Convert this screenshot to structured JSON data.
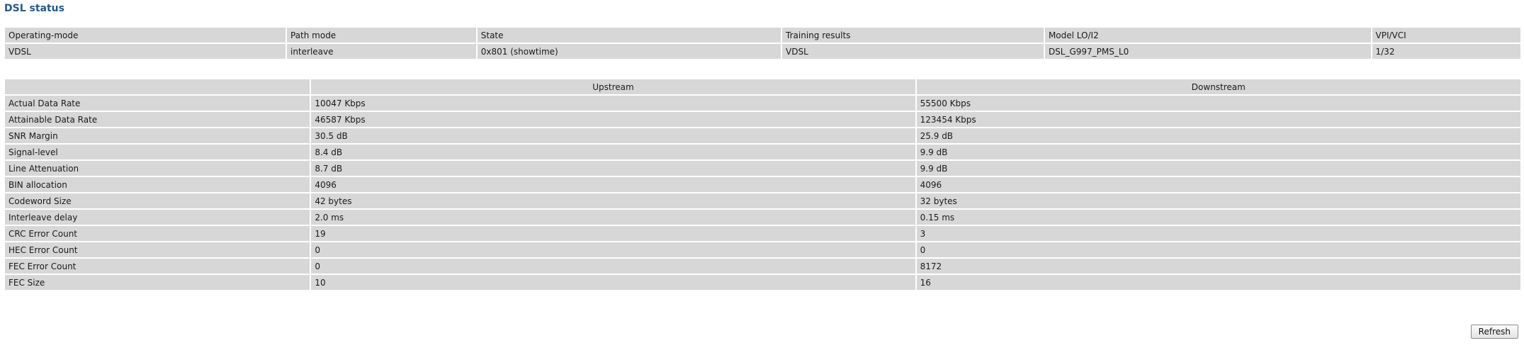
{
  "title": "DSL status",
  "summary": {
    "headers": [
      "Operating-mode",
      "Path mode",
      "State",
      "Training results",
      "Model LO/I2",
      "VPI/VCI"
    ],
    "values": [
      "VDSL",
      "interleave",
      "0x801 (showtime)",
      "VDSL",
      "DSL_G997_PMS_L0",
      "1/32"
    ]
  },
  "stats": {
    "headers": [
      "",
      "Upstream",
      "Downstream"
    ],
    "rows": [
      {
        "label": "Actual Data Rate",
        "upstream": "10047 Kbps",
        "downstream": "55500 Kbps"
      },
      {
        "label": "Attainable Data Rate",
        "upstream": "46587 Kbps",
        "downstream": "123454 Kbps"
      },
      {
        "label": "SNR Margin",
        "upstream": "30.5 dB",
        "downstream": "25.9 dB"
      },
      {
        "label": "Signal-level",
        "upstream": "8.4 dB",
        "downstream": "9.9 dB"
      },
      {
        "label": "Line Attenuation",
        "upstream": "8.7 dB",
        "downstream": "9.9 dB"
      },
      {
        "label": "BIN allocation",
        "upstream": "4096",
        "downstream": "4096"
      },
      {
        "label": "Codeword Size",
        "upstream": "42 bytes",
        "downstream": "32 bytes"
      },
      {
        "label": "Interleave delay",
        "upstream": "2.0 ms",
        "downstream": "0.15 ms"
      },
      {
        "label": "CRC Error Count",
        "upstream": "19",
        "downstream": "3"
      },
      {
        "label": "HEC Error Count",
        "upstream": "0",
        "downstream": "0"
      },
      {
        "label": "FEC Error Count",
        "upstream": "0",
        "downstream": "8172"
      },
      {
        "label": "FEC Size",
        "upstream": "10",
        "downstream": "16"
      }
    ]
  },
  "refresh_label": "Refresh"
}
